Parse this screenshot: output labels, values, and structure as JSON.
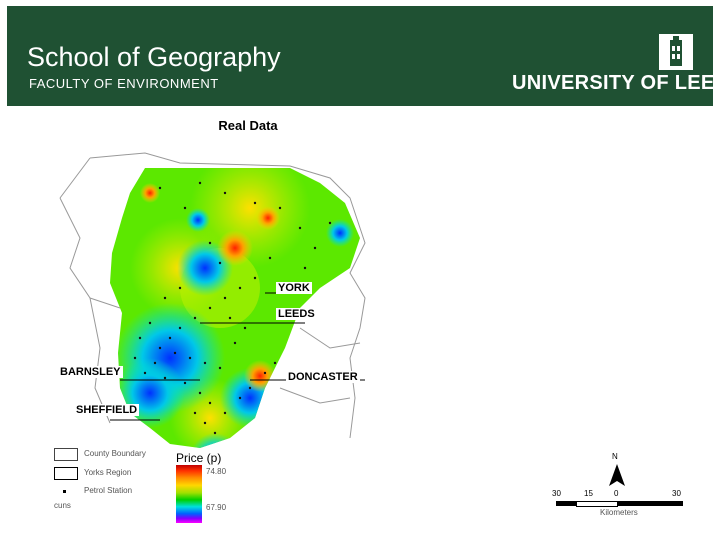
{
  "header": {
    "school": "School of Geography",
    "faculty": "FACULTY OF ENVIRONMENT",
    "university": "UNIVERSITY OF LEEDS",
    "bg_color": "#1f5133"
  },
  "figure": {
    "title": "Real Data",
    "cities": {
      "york": "YORK",
      "leeds": "LEEDS",
      "barnsley": "BARNSLEY",
      "doncaster": "DONCASTER",
      "sheffield": "SHEFFIELD"
    },
    "legend": {
      "county_boundary": "County Boundary",
      "yorks_region": "Yorks Region",
      "petrol_station": "Petrol Station",
      "footer": "cuns"
    },
    "price": {
      "title": "Price (p)",
      "max": "74.80",
      "min": "67.90"
    },
    "scale": {
      "north": "N",
      "labels": [
        "30",
        "15",
        "0",
        "30"
      ],
      "unit": "Kilometers"
    }
  }
}
